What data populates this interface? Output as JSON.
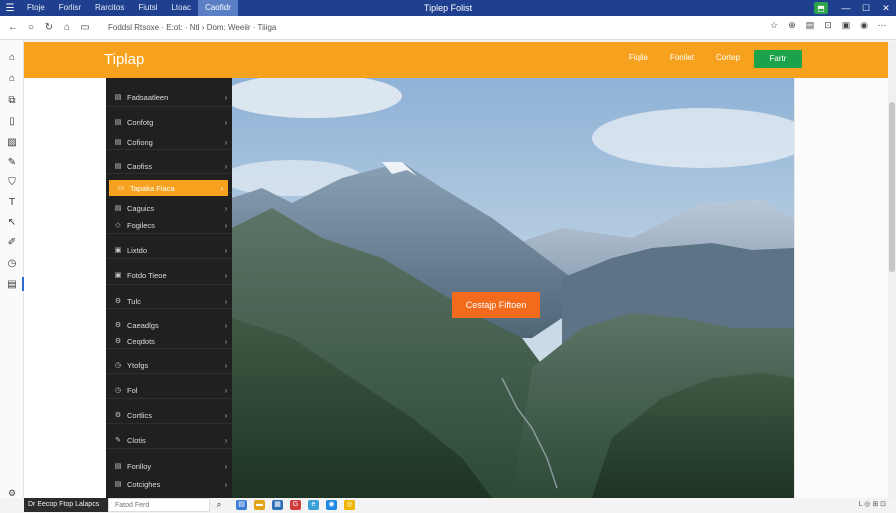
{
  "titlebar": {
    "menu": [
      "Ftoje",
      "Forlisr",
      "Rarcitos",
      "Fiutsl",
      "Ltoac",
      "Caofidr"
    ],
    "active_menu_index": 5,
    "title": "Tiplep Folist",
    "window_icon": "menu-icon",
    "controls": {
      "green": "app-icon",
      "min": "—",
      "max": "☐",
      "close": "✕"
    }
  },
  "addressbar": {
    "url": "Foddsl Rtsoxe  ·  E:ot: · Ntl  ›  Dom: Weeiir · Tiiiga",
    "nav_icons": [
      "back-icon",
      "forward-icon",
      "refresh-icon",
      "home-icon"
    ]
  },
  "page": {
    "logo": "Tiplap",
    "nav": [
      "Fiqile",
      "Fonilet",
      "Cortep"
    ],
    "cta_label": "Fartr",
    "hero_button": "Cestajp Fiftoen",
    "sidebar": [
      {
        "label": "Fadsaatleen",
        "icon": "list-icon"
      },
      {
        "label": "Confotg",
        "icon": "list-icon"
      },
      {
        "label": "Cofiong",
        "icon": "list-icon"
      },
      {
        "label": "Caofiss",
        "icon": "list-icon"
      },
      {
        "label": "Tapaka Fiaca",
        "icon": "folder-icon",
        "active": true
      },
      {
        "label": "Caguics",
        "icon": "list-icon"
      },
      {
        "label": "Fogilecs",
        "icon": "tag-icon"
      },
      {
        "label": "Lixtdo",
        "icon": "lock-icon"
      },
      {
        "label": "Fotdo Tieoe",
        "icon": "lock-icon"
      },
      {
        "label": "Tulc",
        "icon": "gear-icon"
      },
      {
        "label": "Caeadlgs",
        "icon": "gear-icon"
      },
      {
        "label": "Ceqdots",
        "icon": "gear-icon"
      },
      {
        "label": "Ytofgs",
        "icon": "clock-icon"
      },
      {
        "label": "Fol",
        "icon": "clock-icon"
      },
      {
        "label": "Cortlics",
        "icon": "gear-icon"
      },
      {
        "label": "Clotis",
        "icon": "pen-icon"
      },
      {
        "label": "Fonlloy",
        "icon": "list-icon"
      },
      {
        "label": "Cotcighes",
        "icon": "list-icon"
      }
    ]
  },
  "taskbar": {
    "start_label": "Dr  Eecop  Ftop  Lalapcs",
    "search_placeholder": "Fatod Ferd",
    "tray_text": "L  ◎  ⊞  ⊡"
  }
}
